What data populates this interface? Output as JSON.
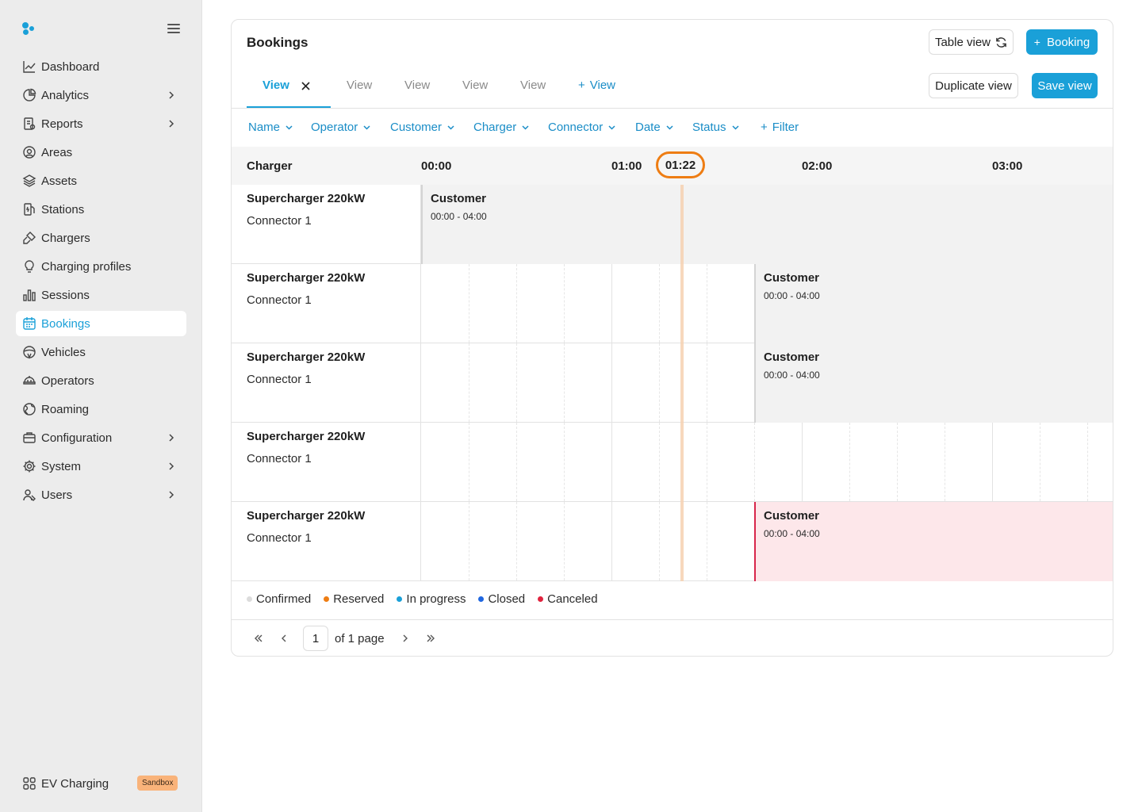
{
  "sidebar": {
    "items": [
      {
        "label": "Dashboard",
        "icon": "chart-line-icon",
        "chevron": false
      },
      {
        "label": "Analytics",
        "icon": "pie-chart-icon",
        "chevron": true
      },
      {
        "label": "Reports",
        "icon": "report-icon",
        "chevron": true
      },
      {
        "label": "Areas",
        "icon": "map-pin-icon",
        "chevron": false
      },
      {
        "label": "Assets",
        "icon": "layers-icon",
        "chevron": false
      },
      {
        "label": "Stations",
        "icon": "station-icon",
        "chevron": false
      },
      {
        "label": "Chargers",
        "icon": "plug-icon",
        "chevron": false
      },
      {
        "label": "Charging profiles",
        "icon": "bulb-icon",
        "chevron": false
      },
      {
        "label": "Sessions",
        "icon": "bar-chart-icon",
        "chevron": false
      },
      {
        "label": "Bookings",
        "icon": "calendar-icon",
        "chevron": false,
        "active": true
      },
      {
        "label": "Vehicles",
        "icon": "steering-wheel-icon",
        "chevron": false
      },
      {
        "label": "Operators",
        "icon": "operator-icon",
        "chevron": false
      },
      {
        "label": "Roaming",
        "icon": "globe-icon",
        "chevron": false
      },
      {
        "label": "Configuration",
        "icon": "briefcase-icon",
        "chevron": true
      },
      {
        "label": "System",
        "icon": "gear-icon",
        "chevron": true
      },
      {
        "label": "Users",
        "icon": "users-icon",
        "chevron": true
      }
    ],
    "footer": {
      "label": "EV Charging",
      "badge": "Sandbox"
    }
  },
  "header": {
    "title": "Bookings",
    "table_view": "Table view",
    "booking_button": "Booking",
    "duplicate_view": "Duplicate view",
    "save_view": "Save view"
  },
  "tabs": {
    "active": "View",
    "items": [
      "View",
      "View",
      "View",
      "View"
    ],
    "add": "View"
  },
  "filters": [
    "Name",
    "Operator",
    "Customer",
    "Charger",
    "Connector",
    "Date",
    "Status"
  ],
  "add_filter": "Filter",
  "timeline": {
    "column_label": "Charger",
    "hours": [
      "00:00",
      "01:00",
      "02:00",
      "03:00"
    ],
    "now": "01:22",
    "rows": [
      {
        "charger": "Supercharger 220kW",
        "connector": "Connector 1",
        "booking": {
          "title": "Customer",
          "time": "00:00 - 04:00",
          "status": "confirmed"
        }
      },
      {
        "charger": "Supercharger 220kW",
        "connector": "Connector 1",
        "booking": {
          "title": "Customer",
          "time": "00:00 - 04:00",
          "status": "confirmed"
        }
      },
      {
        "charger": "Supercharger 220kW",
        "connector": "Connector 1",
        "booking": {
          "title": "Customer",
          "time": "00:00 - 04:00",
          "status": "confirmed"
        }
      },
      {
        "charger": "Supercharger 220kW",
        "connector": "Connector 1",
        "booking": null
      },
      {
        "charger": "Supercharger 220kW",
        "connector": "Connector 1",
        "booking": {
          "title": "Customer",
          "time": "00:00 - 04:00",
          "status": "canceled"
        }
      }
    ]
  },
  "legend": [
    {
      "label": "Confirmed",
      "color": "#dcdcdc"
    },
    {
      "label": "Reserved",
      "color": "#ee7d13"
    },
    {
      "label": "In progress",
      "color": "#1aa0d8"
    },
    {
      "label": "Closed",
      "color": "#1f66e0"
    },
    {
      "label": "Canceled",
      "color": "#e0233e"
    }
  ],
  "pager": {
    "page": "1",
    "text": "of 1 page"
  },
  "colors": {
    "accent": "#1aa0d8",
    "now": "#ee7d13",
    "canceled": "#d8264b"
  }
}
